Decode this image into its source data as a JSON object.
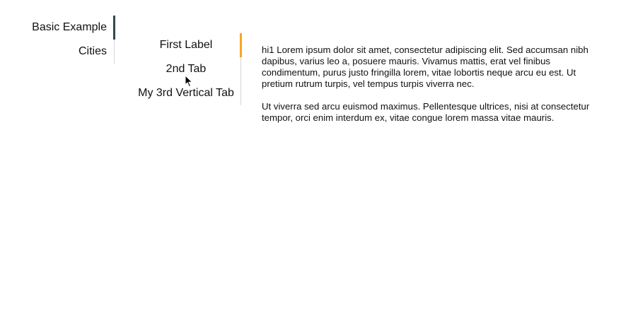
{
  "colors": {
    "outer_active_indicator": "#2e4a4f",
    "inner_active_indicator": "#f5a623",
    "divider": "#d6d6d6"
  },
  "outer_tabs": {
    "items": [
      {
        "label": "Basic Example",
        "active": true
      },
      {
        "label": "Cities",
        "active": false
      }
    ]
  },
  "inner_tabs": {
    "items": [
      {
        "label": "First Label",
        "active": true
      },
      {
        "label": "2nd Tab",
        "active": false
      },
      {
        "label": "My 3rd Vertical Tab",
        "active": false
      }
    ]
  },
  "panel": {
    "paragraphs": [
      "hi1 Lorem ipsum dolor sit amet, consectetur adipiscing elit. Sed accumsan nibh dapibus, varius leo a, posuere mauris. Vivamus mattis, erat vel finibus condimentum, purus justo fringilla lorem, vitae lobortis neque arcu eu est. Ut pretium rutrum turpis, vel tempus turpis viverra nec.",
      "Ut viverra sed arcu euismod maximus. Pellentesque ultrices, nisi at consectetur tempor, orci enim interdum ex, vitae congue lorem massa vitae mauris."
    ]
  },
  "cursor": {
    "icon": "mouse-pointer-icon"
  }
}
